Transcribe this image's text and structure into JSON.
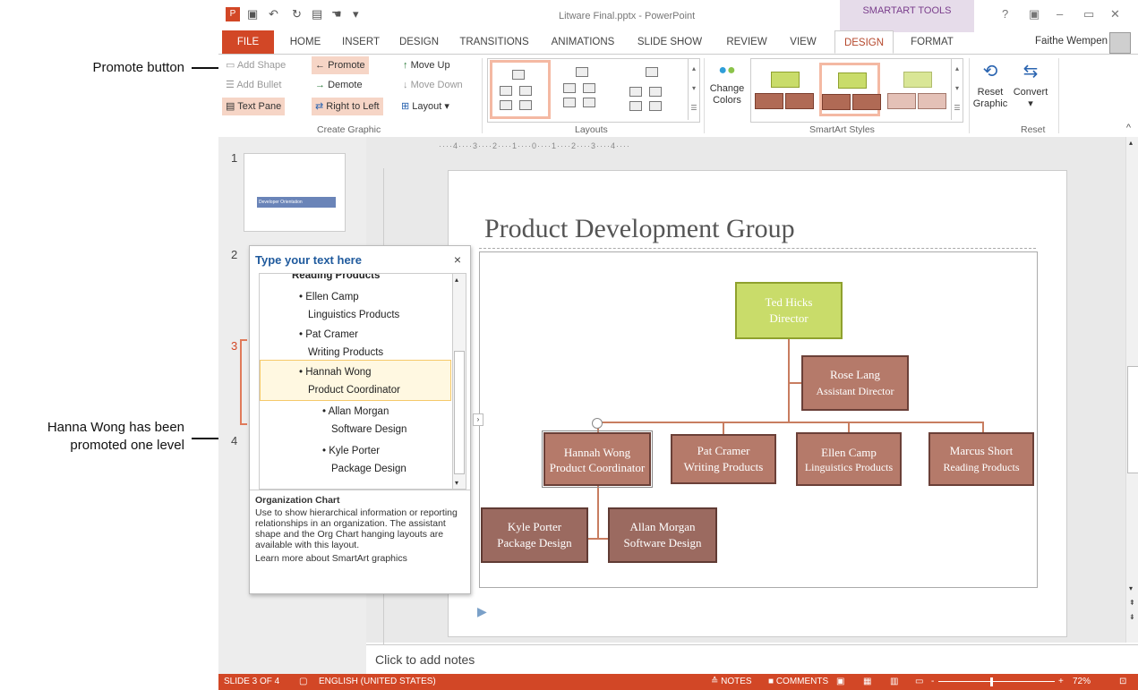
{
  "callouts": {
    "promote": "Promote button",
    "hanna_line1": "Hanna Wong has been",
    "hanna_line2": "promoted one level"
  },
  "window": {
    "title": "Litware Final.pptx - PowerPoint",
    "contextual_tab_group": "SMARTART TOOLS",
    "user": "Faithe Wempen",
    "controls": [
      "?",
      "▣",
      "–",
      "▭",
      "✕"
    ]
  },
  "tabs": [
    "FILE",
    "HOME",
    "INSERT",
    "DESIGN",
    "TRANSITIONS",
    "ANIMATIONS",
    "SLIDE SHOW",
    "REVIEW",
    "VIEW",
    "DESIGN",
    "FORMAT"
  ],
  "ribbon": {
    "create_graphic": {
      "add_shape": "Add Shape",
      "add_bullet": "Add Bullet",
      "text_pane": "Text Pane",
      "promote": "Promote",
      "demote": "Demote",
      "right_to_left": "Right to Left",
      "move_up": "Move Up",
      "move_down": "Move Down",
      "layout": "Layout",
      "label": "Create Graphic"
    },
    "layouts": {
      "label": "Layouts"
    },
    "smartart_styles": {
      "change_colors_1": "Change",
      "change_colors_2": "Colors",
      "label": "SmartArt Styles"
    },
    "reset": {
      "reset_graphic_1": "Reset",
      "reset_graphic_2": "Graphic",
      "convert": "Convert",
      "label": "Reset"
    }
  },
  "ruler": {
    "ticks": "····4····3····2····1····0····1····2····3····4····"
  },
  "thumbnails": [
    "1",
    "2",
    "3",
    "4"
  ],
  "thumb1_text": "Developer Orientation",
  "slide": {
    "title": "Product Development Group",
    "nodes": {
      "director_name": "Ted Hicks",
      "director_role": "Director",
      "assistant_name": "Rose Lang",
      "assistant_role": "Assistant Director",
      "hannah_name": "Hannah Wong",
      "hannah_role": "Product Coordinator",
      "pat_name": "Pat Cramer",
      "pat_role": "Writing Products",
      "ellen_name": "Ellen Camp",
      "ellen_role": "Linguistics Products",
      "marcus_name": "Marcus Short",
      "marcus_role": "Reading Products",
      "kyle_name": "Kyle Porter",
      "kyle_role": "Package Design",
      "allan_name": "Allan Morgan",
      "allan_role": "Software Design"
    }
  },
  "text_pane": {
    "title": "Type your text here",
    "close": "×",
    "items": [
      "Reading Products",
      "• Ellen Camp",
      "Linguistics Products",
      "• Pat Cramer",
      "Writing Products",
      "• Hannah Wong",
      "Product Coordinator",
      "• Allan Morgan",
      "Software Design",
      "• Kyle Porter",
      "Package Design"
    ],
    "desc_heading": "Organization Chart",
    "desc_body": "Use to show hierarchical information or reporting relationships in an organization. The assistant shape and the Org Chart hanging layouts are available with this layout.",
    "desc_link": "Learn more about SmartArt graphics"
  },
  "notes_placeholder": "Click to add notes",
  "status": {
    "slide": "SLIDE 3 OF 4",
    "language": "ENGLISH (UNITED STATES)",
    "notes": "≙ NOTES",
    "comments": "■ COMMENTS",
    "zoom": "72%"
  },
  "colors": {
    "accent": "#d24726",
    "node_fill": "#b57a6a",
    "top_node_fill": "#c9dc6a",
    "contextual": "#e6dcea"
  }
}
